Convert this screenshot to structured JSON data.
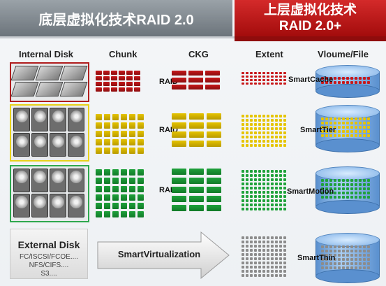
{
  "header": {
    "left_title": "底层虚拟化技术RAID 2.0",
    "right_title_line1": "上层虚拟化技术",
    "right_title_line2": "RAID 2.0+"
  },
  "columns": {
    "internal_disk": "Internal Disk",
    "chunk": "Chunk",
    "ckg": "CKG",
    "extent": "Extent",
    "volume_file": "Vloume/File"
  },
  "rows": [
    {
      "raid_label": "RAID",
      "feature": "SmartCache",
      "color": "#c8181a"
    },
    {
      "raid_label": "RAID",
      "feature": "SmartTier",
      "color": "#e6c400"
    },
    {
      "raid_label": "RAID",
      "feature": "SmartMotion",
      "color": "#1fa23b"
    }
  ],
  "external": {
    "title": "External Disk",
    "line1": "FC/ISCSI/FCOE....",
    "line2": "NFS/CIFS....",
    "line3": "S3....",
    "arrow_label": "SmartVirtualization",
    "feature": "SmartThin"
  },
  "colors": {
    "header_gray": "#7e868c",
    "header_red": "#c01a1a",
    "storage_blue": "#6a9fd8",
    "extent_gray": "#8c8c8c"
  }
}
